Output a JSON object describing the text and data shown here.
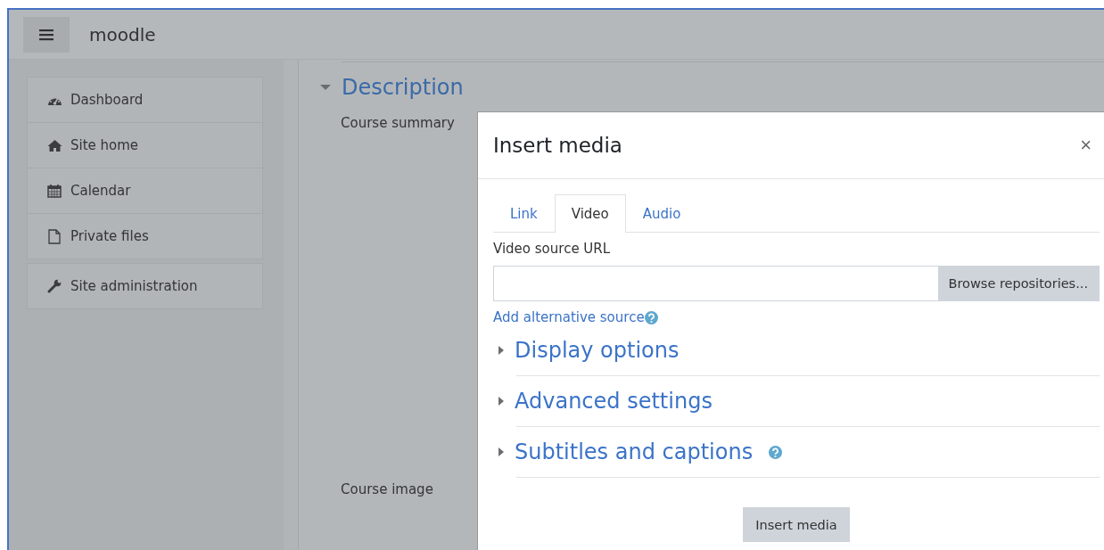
{
  "header": {
    "site_name": "moodle"
  },
  "nav": {
    "groups": [
      {
        "items": [
          {
            "label": "Dashboard"
          },
          {
            "label": "Site home"
          },
          {
            "label": "Calendar"
          },
          {
            "label": "Private files"
          }
        ]
      },
      {
        "items": [
          {
            "label": "Site administration"
          }
        ]
      }
    ]
  },
  "form": {
    "section": {
      "title": "Description",
      "expanded": true
    },
    "fields": [
      {
        "label": "Course summary"
      },
      {
        "label": "Course image"
      }
    ]
  },
  "dialog": {
    "title": "Insert media",
    "close": "×",
    "tabs": [
      {
        "label": "Link",
        "selected": false
      },
      {
        "label": "Video",
        "selected": true
      },
      {
        "label": "Audio",
        "selected": false
      }
    ],
    "url_label": "Video source URL",
    "browse_button": "Browse repositories...",
    "alt_source_link": "Add alternative source",
    "sections": [
      {
        "title": "Display options",
        "expanded": false,
        "help": false
      },
      {
        "title": "Advanced settings",
        "expanded": false,
        "help": false
      },
      {
        "title": "Subtitles and captions",
        "expanded": false,
        "help": true
      }
    ],
    "submit": "Insert media"
  }
}
